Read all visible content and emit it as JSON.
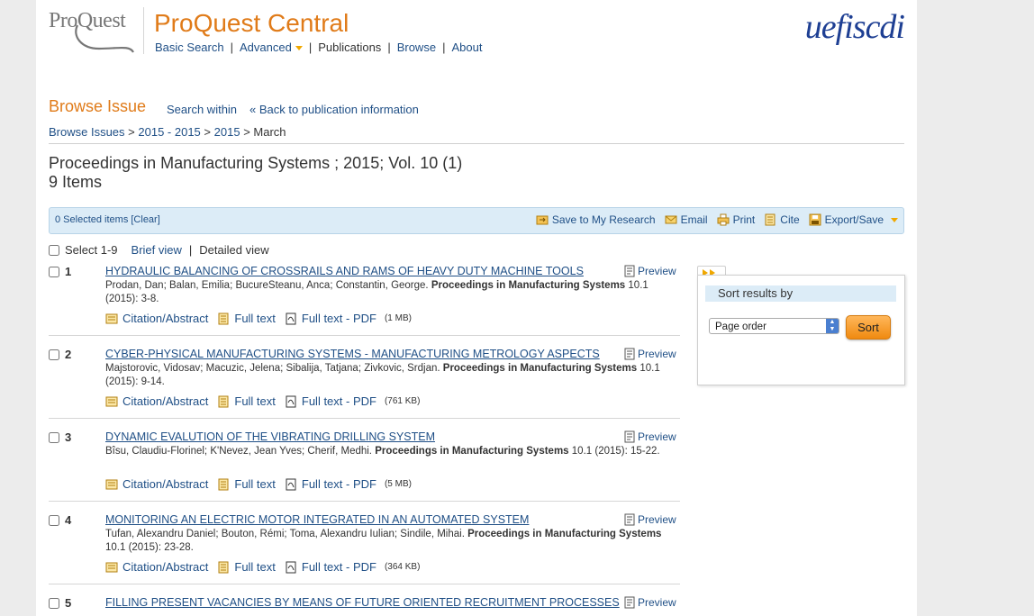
{
  "header": {
    "logo_text": "ProQuest",
    "app_title": "ProQuest Central",
    "nav": [
      "Basic Search",
      "Advanced",
      "Publications",
      "Browse",
      "About"
    ],
    "institution_logo_text": "uefiscdi"
  },
  "browse": {
    "title": "Browse Issue",
    "search_within": "Search within",
    "back_link": "« Back to publication information",
    "breadcrumb": {
      "b0": "Browse Issues",
      "b1": "2015 - 2015",
      "b2": "2015",
      "b3": "March",
      "sep": ">"
    }
  },
  "publication": {
    "title": "Proceedings in Manufacturing Systems ; 2015; Vol. 10 (1)",
    "item_count": "9 Items"
  },
  "toolbar": {
    "selected": "0 Selected items [Clear]",
    "save": "Save to My Research",
    "email": "Email",
    "print": "Print",
    "cite": "Cite",
    "export": "Export/Save"
  },
  "select_row": {
    "select_label": "Select 1-9",
    "brief": "Brief view",
    "detailed": "Detailed view",
    "sep": "|"
  },
  "results": [
    {
      "num": "1",
      "title": "HYDRAULIC BALANCING OF CROSSRAILS AND RAMS OF HEAVY DUTY MACHINE TOOLS",
      "authors": "Prodan, Dan; Balan, Emilia; BucureSteanu, Anca; Constantin, George.",
      "journal": "Proceedings in Manufacturing Systems",
      "citation": "10.1  (2015): 3-8.",
      "pdf_size": "(1 MB)"
    },
    {
      "num": "2",
      "title": "CYBER-PHYSICAL MANUFACTURING SYSTEMS - MANUFACTURING METROLOGY ASPECTS",
      "authors": "Majstorovic, Vidosav; Macuzic, Jelena; Sibalija, Tatjana; Zivkovic, Srdjan.",
      "journal": "Proceedings in Manufacturing Systems",
      "citation": "10.1  (2015): 9-14.",
      "pdf_size": "(761 KB)"
    },
    {
      "num": "3",
      "title": "DYNAMIC EVALUTION OF THE VIBRATING DRILLING SYSTEM",
      "authors": "Bîsu, Claudiu-Florinel; K'Nevez, Jean Yves; Cherif, Medhi.",
      "journal": "Proceedings in Manufacturing Systems",
      "citation": "10.1 (2015): 15-22.",
      "pdf_size": "(5 MB)"
    },
    {
      "num": "4",
      "title": "MONITORING AN ELECTRIC MOTOR INTEGRATED IN AN AUTOMATED SYSTEM",
      "authors": "Tufan, Alexandru Daniel; Bouton, Rémi; Toma, Alexandru Iulian; Sindile, Mihai.",
      "journal": "Proceedings in Manufacturing Systems",
      "citation": "10.1  (2015): 23-28.",
      "pdf_size": "(364 KB)"
    },
    {
      "num": "5",
      "title": "FILLING PRESENT VACANCIES BY MEANS OF FUTURE ORIENTED RECRUITMENT PROCESSES"
    }
  ],
  "result_links": {
    "preview": "Preview",
    "citation": "Citation/Abstract",
    "fulltext": "Full text",
    "pdf": "Full text - PDF"
  },
  "sort": {
    "heading": "Sort results by",
    "selected": "Page order",
    "button": "Sort"
  },
  "colors": {
    "brand_orange": "#e07b19",
    "link_blue": "#1f4f86",
    "toolbar_bg": "#dcecf7"
  }
}
